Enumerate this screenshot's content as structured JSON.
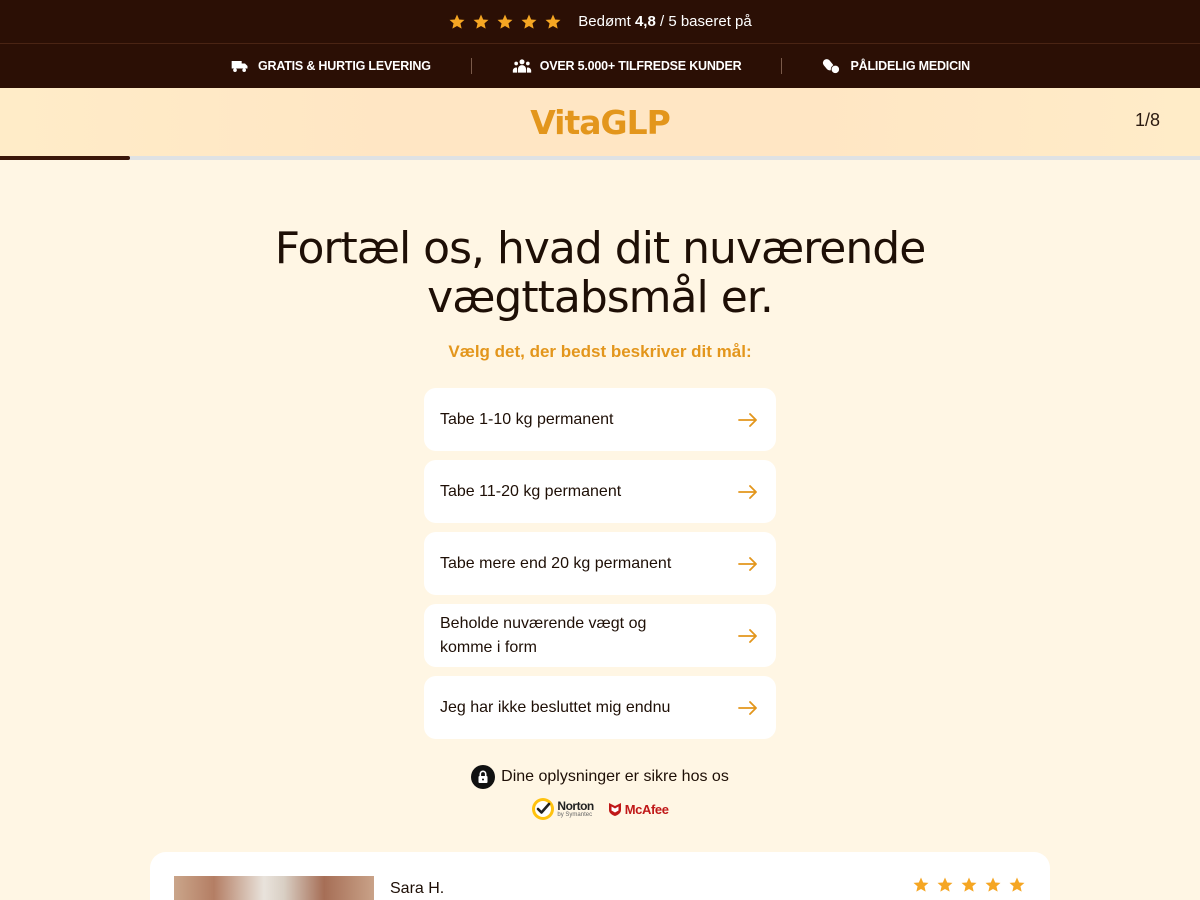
{
  "top_bar": {
    "stars": 5,
    "rating_prefix": "Bedømt",
    "rating_value": "4,8",
    "rating_suffix": "/ 5 baseret på",
    "star_color": "#f5a623"
  },
  "features": [
    {
      "icon": "truck-icon",
      "label": "GRATIS & HURTIG LEVERING"
    },
    {
      "icon": "people-icon",
      "label": "OVER 5.000+ TILFREDSE KUNDER"
    },
    {
      "icon": "pills-icon",
      "label": "PÅLIDELIG MEDICIN"
    }
  ],
  "header": {
    "logo": "VitaGLP",
    "step": "1/8",
    "progress": 0.108
  },
  "quiz": {
    "question": "Fortæl os, hvad dit nuværende vægttabsmål er.",
    "subtitle": "Vælg det, der bedst beskriver dit mål:",
    "options": [
      "Tabe 1-10 kg permanent",
      "Tabe 11-20 kg permanent",
      "Tabe mere end 20 kg permanent",
      "Beholde nuværende vægt og komme i form",
      "Jeg har ikke besluttet mig endnu"
    ]
  },
  "security": {
    "text": "Dine oplysninger er sikre hos os",
    "norton_name": "Norton",
    "norton_sub": "by Symantec",
    "mcafee": "McAfee"
  },
  "review": {
    "name": "Sara H.",
    "stars": 5
  },
  "colors": {
    "accent": "#e3961c",
    "dark": "#2b0f05",
    "background": "#fff6e4"
  }
}
